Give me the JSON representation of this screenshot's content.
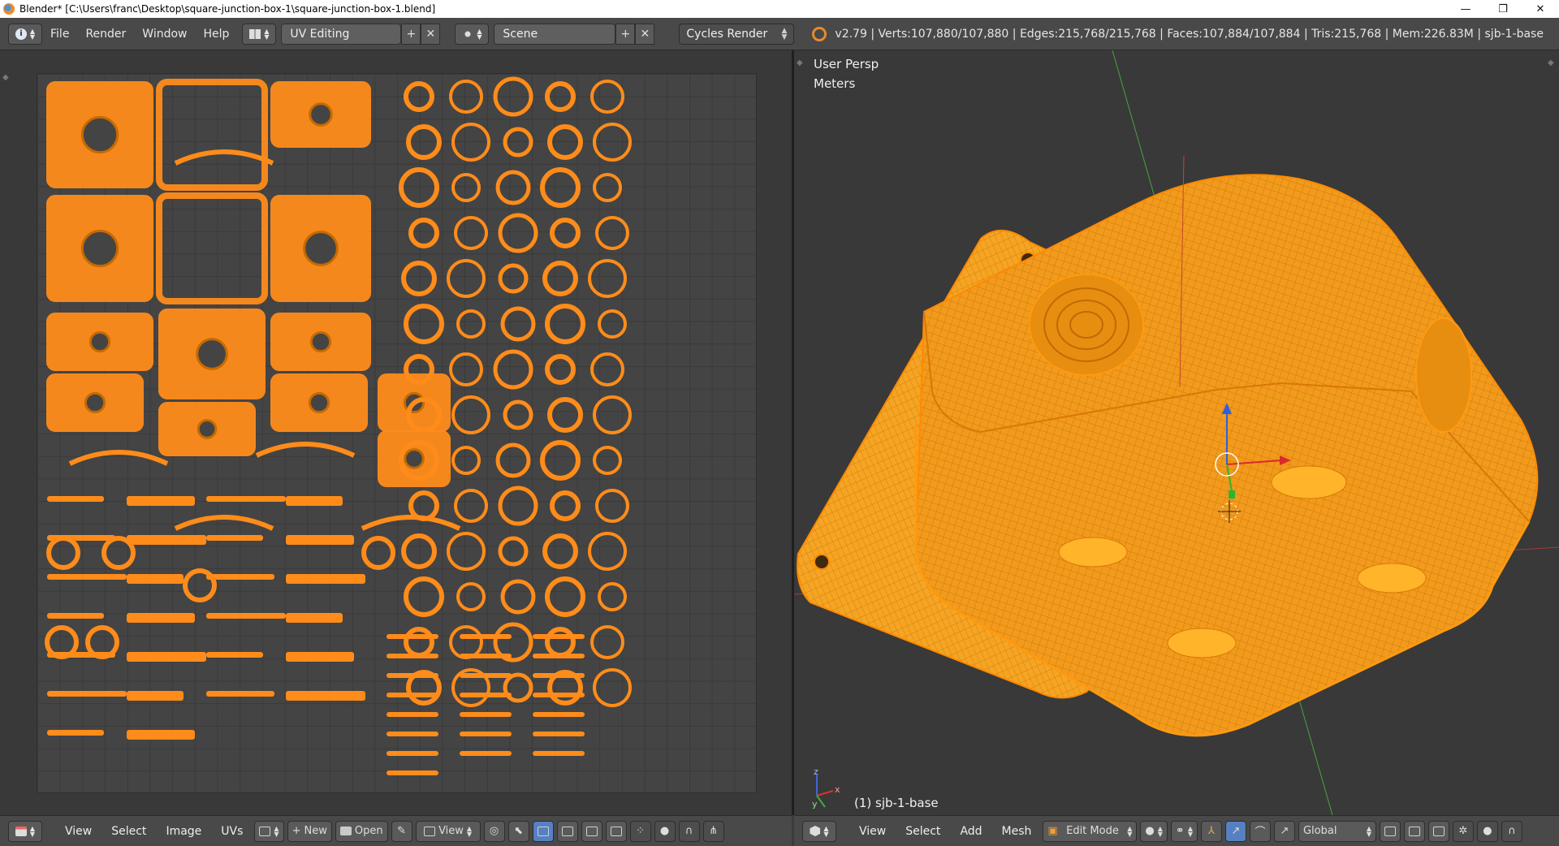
{
  "window": {
    "title": "Blender* [C:\\Users\\franc\\Desktop\\square-junction-box-1\\square-junction-box-1.blend]",
    "min": "—",
    "restore": "❐",
    "close": "✕"
  },
  "info_header": {
    "menus": [
      "File",
      "Render",
      "Window",
      "Help"
    ],
    "screen_layout": "UV Editing",
    "scene": "Scene",
    "render_engine": "Cycles Render",
    "stats": "v2.79 | Verts:107,880/107,880 | Edges:215,768/215,768 | Faces:107,884/107,884 | Tris:215,768 | Mem:226.83M | sjb-1-base"
  },
  "uv_editor": {
    "menus": [
      "View",
      "Select",
      "Image",
      "UVs"
    ],
    "new_label": "New",
    "open_label": "Open",
    "view_label": "View"
  },
  "view3d": {
    "projection_label": "User Persp",
    "units_label": "Meters",
    "object_label": "(1) sjb-1-base",
    "axis_x": "x",
    "axis_y": "y",
    "axis_z": "z",
    "menus": [
      "View",
      "Select",
      "Add",
      "Mesh"
    ],
    "mode": "Edit Mode",
    "orientation": "Global"
  },
  "colors": {
    "uv_orange": "#ff8c1a",
    "mesh_orange": "#f7a01e",
    "header_bg": "#494949",
    "active_blue": "#5680c2"
  }
}
